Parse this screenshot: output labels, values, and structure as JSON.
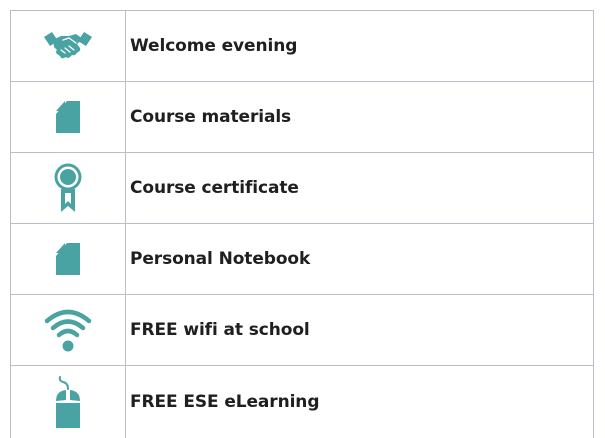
{
  "colors": {
    "icon": "#4aa3a3",
    "border": "#b9bfc9",
    "text": "#1f1f1f"
  },
  "features": [
    {
      "icon": "handshake-icon",
      "label": "Welcome evening"
    },
    {
      "icon": "document-icon",
      "label": "Course materials"
    },
    {
      "icon": "certificate-ribbon-icon",
      "label": "Course certificate"
    },
    {
      "icon": "document-icon",
      "label": "Personal Notebook"
    },
    {
      "icon": "wifi-icon",
      "label": "FREE wifi at school"
    },
    {
      "icon": "mouse-icon",
      "label": "FREE ESE eLearning"
    }
  ]
}
